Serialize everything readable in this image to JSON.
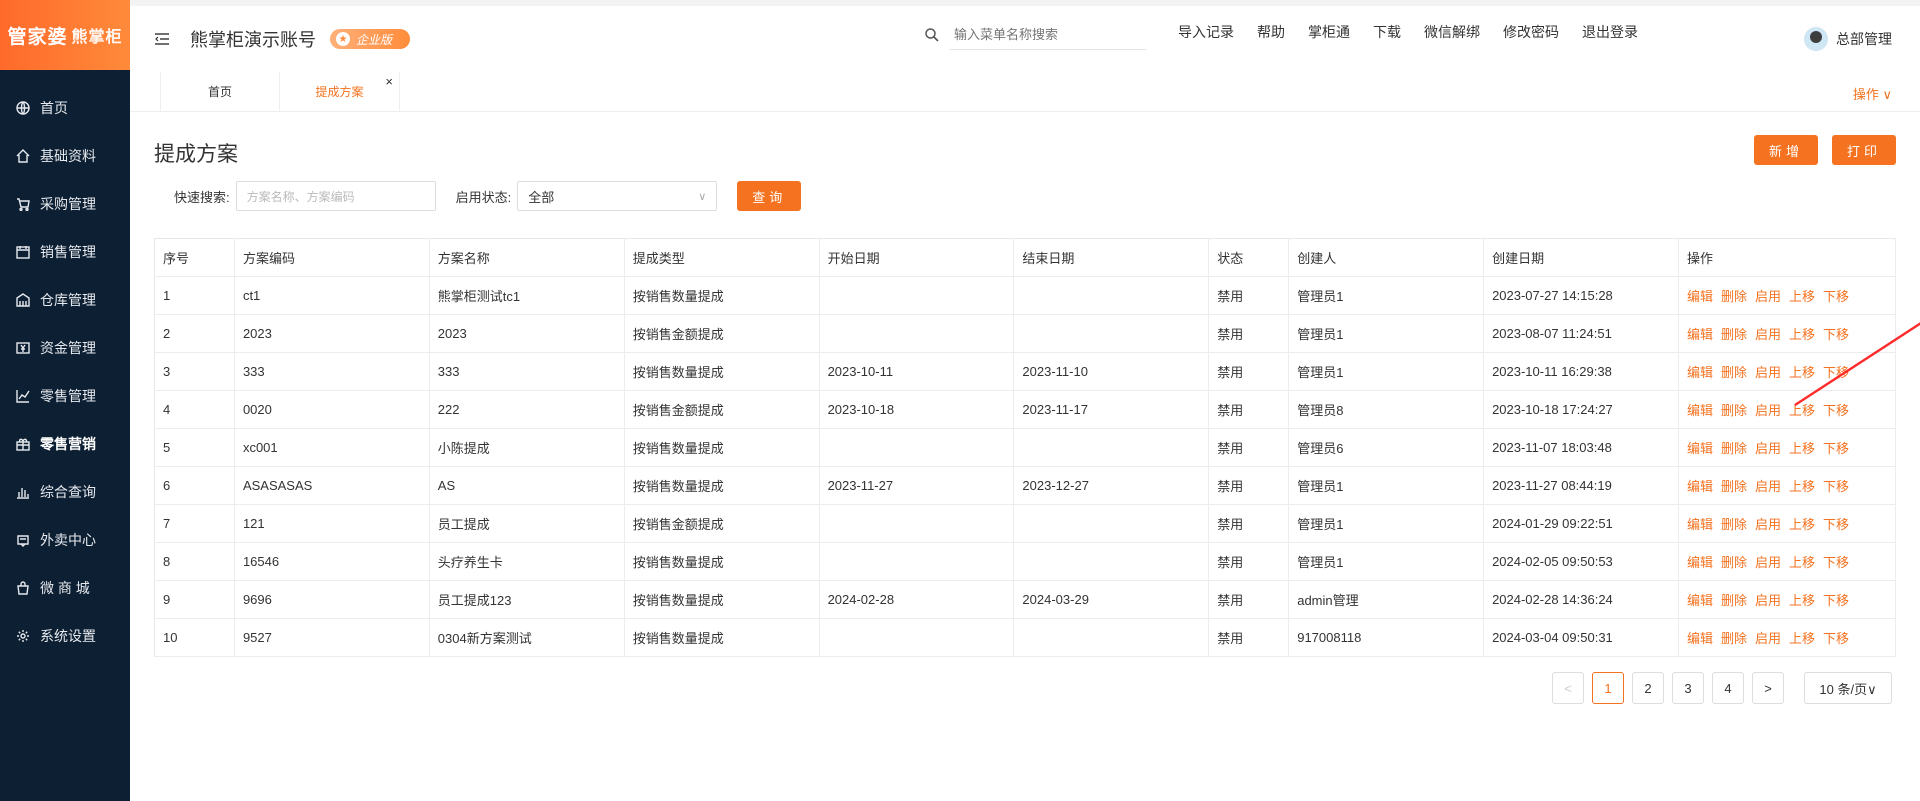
{
  "logo": {
    "main": "管家婆",
    "sub": "熊掌柜"
  },
  "sidebar": {
    "items": [
      {
        "label": "首页",
        "icon": "globe-icon"
      },
      {
        "label": "基础资料",
        "icon": "home-icon"
      },
      {
        "label": "采购管理",
        "icon": "cart-icon"
      },
      {
        "label": "销售管理",
        "icon": "calendar-icon"
      },
      {
        "label": "仓库管理",
        "icon": "warehouse-icon"
      },
      {
        "label": "资金管理",
        "icon": "money-icon"
      },
      {
        "label": "零售管理",
        "icon": "chart-icon"
      },
      {
        "label": "零售营销",
        "icon": "gift-icon"
      },
      {
        "label": "综合查询",
        "icon": "bar-icon"
      },
      {
        "label": "外卖中心",
        "icon": "delivery-icon"
      },
      {
        "label": "微 商 城",
        "icon": "bag-icon"
      },
      {
        "label": "系统设置",
        "icon": "gear-icon"
      }
    ],
    "active_index": 7
  },
  "header": {
    "account": "熊掌柜演示账号",
    "badge": "企业版",
    "search_placeholder": "输入菜单名称搜索",
    "links": [
      "导入记录",
      "帮助",
      "掌柜通",
      "下载",
      "微信解绑",
      "修改密码",
      "退出登录"
    ],
    "user": "总部管理"
  },
  "tabs": {
    "items": [
      "首页",
      "提成方案"
    ],
    "active_index": 1,
    "close": "×",
    "ops": "操作 ∨"
  },
  "page": {
    "title": "提成方案",
    "add_btn": "新增",
    "print_btn": "打印",
    "filter": {
      "search_label": "快速搜索:",
      "search_placeholder": "方案名称、方案编码",
      "status_label": "启用状态:",
      "status_value": "全部",
      "query_btn": "查询"
    }
  },
  "table": {
    "columns": [
      "序号",
      "方案编码",
      "方案名称",
      "提成类型",
      "开始日期",
      "结束日期",
      "状态",
      "创建人",
      "创建日期",
      "操作"
    ],
    "rows": [
      [
        "1",
        "ct1",
        "熊掌柜测试tc1",
        "按销售数量提成",
        "",
        "",
        "禁用",
        "管理员1",
        "2023-07-27 14:15:28"
      ],
      [
        "2",
        "2023",
        "2023",
        "按销售金额提成",
        "",
        "",
        "禁用",
        "管理员1",
        "2023-08-07 11:24:51"
      ],
      [
        "3",
        "333",
        "333",
        "按销售数量提成",
        "2023-10-11",
        "2023-11-10",
        "禁用",
        "管理员1",
        "2023-10-11 16:29:38"
      ],
      [
        "4",
        "0020",
        "222",
        "按销售金额提成",
        "2023-10-18",
        "2023-11-17",
        "禁用",
        "管理员8",
        "2023-10-18 17:24:27"
      ],
      [
        "5",
        "xc001",
        "小陈提成",
        "按销售数量提成",
        "",
        "",
        "禁用",
        "管理员6",
        "2023-11-07 18:03:48"
      ],
      [
        "6",
        "ASASASAS",
        "AS",
        "按销售数量提成",
        "2023-11-27",
        "2023-12-27",
        "禁用",
        "管理员1",
        "2023-11-27 08:44:19"
      ],
      [
        "7",
        "121",
        "员工提成",
        "按销售金额提成",
        "",
        "",
        "禁用",
        "管理员1",
        "2024-01-29 09:22:51"
      ],
      [
        "8",
        "16546",
        "头疗养生卡",
        "按销售数量提成",
        "",
        "",
        "禁用",
        "管理员1",
        "2024-02-05 09:50:53"
      ],
      [
        "9",
        "9696",
        "员工提成123",
        "按销售数量提成",
        "2024-02-28",
        "2024-03-29",
        "禁用",
        "admin管理",
        "2024-02-28 14:36:24"
      ],
      [
        "10",
        "9527",
        "0304新方案测试",
        "按销售数量提成",
        "",
        "",
        "禁用",
        "917008118",
        "2024-03-04 09:50:31"
      ]
    ],
    "ops": [
      "编辑",
      "删除",
      "启用",
      "上移",
      "下移"
    ]
  },
  "pager": {
    "prev": "<",
    "pages": [
      "1",
      "2",
      "3",
      "4"
    ],
    "current": "1",
    "next": ">",
    "size": "10 条/页∨"
  },
  "colors": {
    "accent": "#f47220",
    "sidebar": "#0c1f33",
    "annotation": "#ff2a2a"
  }
}
